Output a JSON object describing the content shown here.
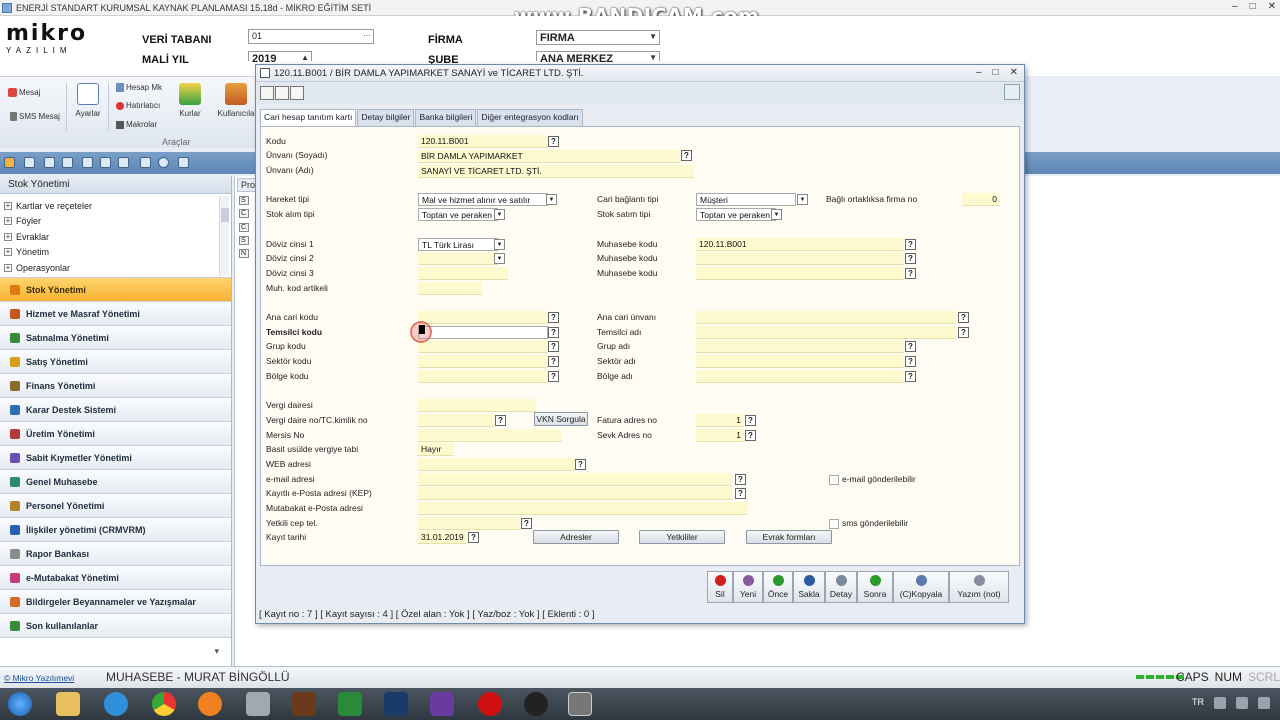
{
  "app": {
    "title": "ENERJİ STANDART KURUMSAL KAYNAK PLANLAMASI 15.18d - MİKRO EĞİTİM SETİ",
    "watermark": "www.BANDICAM.com",
    "logo_big": "mikro",
    "logo_small": "YAZILIM",
    "window_buttons": [
      "–",
      "□",
      "✕"
    ]
  },
  "header": {
    "veritabani_label": "VERİ TABANI",
    "veritabani_value": "01",
    "mali_yil_label": "MALİ YIL",
    "mali_yil_value": "2019",
    "firma_label": "FİRMA",
    "firma_value": "FIRMA",
    "sube_label": "ŞUBE",
    "sube_value": "ANA MERKEZ"
  },
  "ribbon": {
    "items": {
      "mesaj": "Mesaj",
      "sms": "SMS Mesaj",
      "ayarlar": "Ayarlar",
      "hesap": "Hesap Mk",
      "hatirlatici": "Hatırlatıcı",
      "makrolar": "Makrolar",
      "kurlar": "Kurlar",
      "kullanici": "Kullanıcıla"
    },
    "group_label": "Araçlar"
  },
  "leftnav": {
    "title": "Stok Yönetimi",
    "tree": [
      "Kartlar ve reçeteler",
      "Föyler",
      "Evraklar",
      "Yönetim",
      "Operasyonlar"
    ],
    "modules": [
      {
        "label": "Stok Yönetimi",
        "color": "#e07a10",
        "active": true
      },
      {
        "label": "Hizmet ve Masraf Yönetimi",
        "color": "#c4571c"
      },
      {
        "label": "Satınalma Yönetimi",
        "color": "#3a8a3a"
      },
      {
        "label": "Satış Yönetimi",
        "color": "#d4a017"
      },
      {
        "label": "Finans Yönetimi",
        "color": "#8b6b2a"
      },
      {
        "label": "Karar Destek Sistemi",
        "color": "#2d6fb3"
      },
      {
        "label": "Üretim Yönetimi",
        "color": "#b33a3a"
      },
      {
        "label": "Sabit Kıymetler Yönetimi",
        "color": "#6b4fb3"
      },
      {
        "label": "Genel Muhasebe",
        "color": "#2a8a6b"
      },
      {
        "label": "Personel Yönetimi",
        "color": "#b3832a"
      },
      {
        "label": "İlişkiler yönetimi (CRMVRM)",
        "color": "#2a5fb3"
      },
      {
        "label": "Rapor Bankası",
        "color": "#8a8a8a"
      },
      {
        "label": "e-Mutabakat Yönetimi",
        "color": "#c43a7a"
      },
      {
        "label": "Bildirgeler Beyannameler ve Yazışmalar",
        "color": "#d46a2a"
      },
      {
        "label": "Son kullanılanlar",
        "color": "#3a8a3a"
      }
    ],
    "footer_arrow": "▾"
  },
  "bgpanel": {
    "tab": "Prog",
    "items": [
      "S",
      "C",
      "C",
      "S",
      "N"
    ]
  },
  "dialog": {
    "title": "120.11.B001 / BİR DAMLA YAPIMARKET SANAYİ ve TİCARET LTD. ŞTİ.",
    "tabs": [
      "Cari hesap tanıtım kartı",
      "Detay bilgiler",
      "Banka bilgileri",
      "Diğer entegrasyon kodları"
    ],
    "form": {
      "kodu_label": "Kodu",
      "kodu_value": "120.11.B001",
      "unvani_soyadi_label": "Ünvanı (Soyadı)",
      "unvani_soyadi_value": "BİR DAMLA YAPIMARKET",
      "unvani_adi_label": "Ünvanı (Adı)",
      "unvani_adi_value": "SANAYİ VE TİCARET LTD. ŞTİ.",
      "hareket_tipi_label": "Hareket tipi",
      "hareket_tipi_value": "Mal ve hizmet alınır ve satılır",
      "stok_alim_label": "Stok alım tipi",
      "stok_alim_value": "Toptan ve peraken",
      "cari_baglanti_label": "Cari bağlantı tipi",
      "cari_baglanti_value": "Müşteri",
      "stok_satim_label": "Stok satım tipi",
      "stok_satim_value": "Toptan ve peraken",
      "bagli_ortak_label": "Bağlı ortaklıksa firma no",
      "bagli_ortak_value": "0",
      "doviz1_label": "Döviz cinsi 1",
      "doviz1_value": "TL  Türk Lirası",
      "doviz2_label": "Döviz cinsi 2",
      "doviz3_label": "Döviz cinsi 3",
      "muh_kod_artikeli_label": "Muh. kod artikeli",
      "muhasebe1_label": "Muhasebe kodu",
      "muhasebe1_value": "120.11.B001",
      "muhasebe2_label": "Muhasebe kodu",
      "muhasebe3_label": "Muhasebe kodu",
      "ana_cari_kodu_label": "Ana cari kodu",
      "temsilci_kodu_label": "Temsilci kodu",
      "grup_kodu_label": "Grup kodu",
      "sektor_kodu_label": "Sektör kodu",
      "bolge_kodu_label": "Bölge kodu",
      "ana_cari_unvani_label": "Ana cari ünvanı",
      "temsilci_adi_label": "Temsilci adı",
      "grup_adi_label": "Grup adı",
      "sektor_adi_label": "Sektör adı",
      "bolge_adi_label": "Bölge adı",
      "vergi_dairesi_label": "Vergi dairesi",
      "vergi_no_label": "Vergi daire no/TC.kimlik no",
      "mersis_label": "Mersis No",
      "basit_usul_label": "Basit usülde vergiye tabi",
      "basit_usul_value": "Hayır",
      "web_label": "WEB adresi",
      "email_label": "e-mail adresi",
      "kep_label": "Kayıtlı e-Posta adresi (KEP)",
      "mutabakat_label": "Mutabakat e-Posta adresi",
      "yetkili_cep_label": "Yetkili cep tel.",
      "kayit_tarihi_label": "Kayıt tarihi",
      "kayit_tarihi_value": "31.01.2019",
      "vkn_button": "VKN Sorgula",
      "fatura_adres_label": "Fatura adres no",
      "fatura_adres_value": "1",
      "sevk_adres_label": "Sevk Adres no",
      "sevk_adres_value": "1",
      "email_gonder_label": "e-mail gönderilebilir",
      "sms_gonder_label": "sms gönderilebilir",
      "adresler_button": "Adresler",
      "yetkililer_button": "Yetkililer",
      "evrak_formlari_button": "Evrak formları"
    },
    "actions": [
      {
        "label": "Sil",
        "color": "#d02020"
      },
      {
        "label": "Yeni",
        "color": "#8a5a9a"
      },
      {
        "label": "Önce",
        "color": "#2a9a2a"
      },
      {
        "label": "Sakla",
        "color": "#2a5aa0"
      },
      {
        "label": "Detay",
        "color": "#7a8a9a"
      },
      {
        "label": "Sonra",
        "color": "#2a9a2a"
      },
      {
        "label": "(C)Kopyala",
        "color": "#5a7ab0"
      },
      {
        "label": "Yazım (not)",
        "color": "#8a8aa0"
      }
    ],
    "status": "[ Kayıt no : 7 ] [ Kayıt sayısı : 4 ] [ Özel alan : Yok ] [ Yaz/boz : Yok ] [ Eklenti : 0 ]"
  },
  "appstatus": {
    "company_link": "© Mikro Yazılımevi",
    "user": "MUHASEBE - MURAT BİNGÖLLÜ",
    "caps": "CAPS",
    "num": "NUM",
    "scrl": "SCRL"
  },
  "taskbar": {
    "lang": "TR"
  }
}
